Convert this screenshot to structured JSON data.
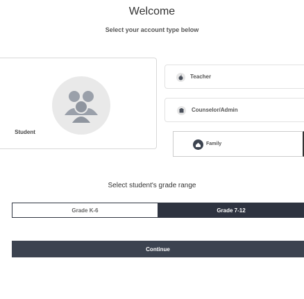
{
  "header": {
    "title": "Welcome",
    "subtitle": "Select your account type below"
  },
  "account_types": {
    "student": {
      "label": "Student",
      "icon": "users-icon"
    },
    "teacher": {
      "label": "Teacher",
      "icon": "apple-icon"
    },
    "counselor": {
      "label": "Counselor/Admin",
      "icon": "briefcase-icon"
    },
    "family": {
      "label": "Family",
      "icon": "home-icon"
    }
  },
  "grade": {
    "heading": "Select student's grade range",
    "options": [
      "Grade K-6",
      "Grade 7-12"
    ],
    "selected": "Grade 7-12"
  },
  "actions": {
    "continue_label": "Continue"
  },
  "colors": {
    "accent": "#2e3340",
    "button": "#3c4350"
  }
}
